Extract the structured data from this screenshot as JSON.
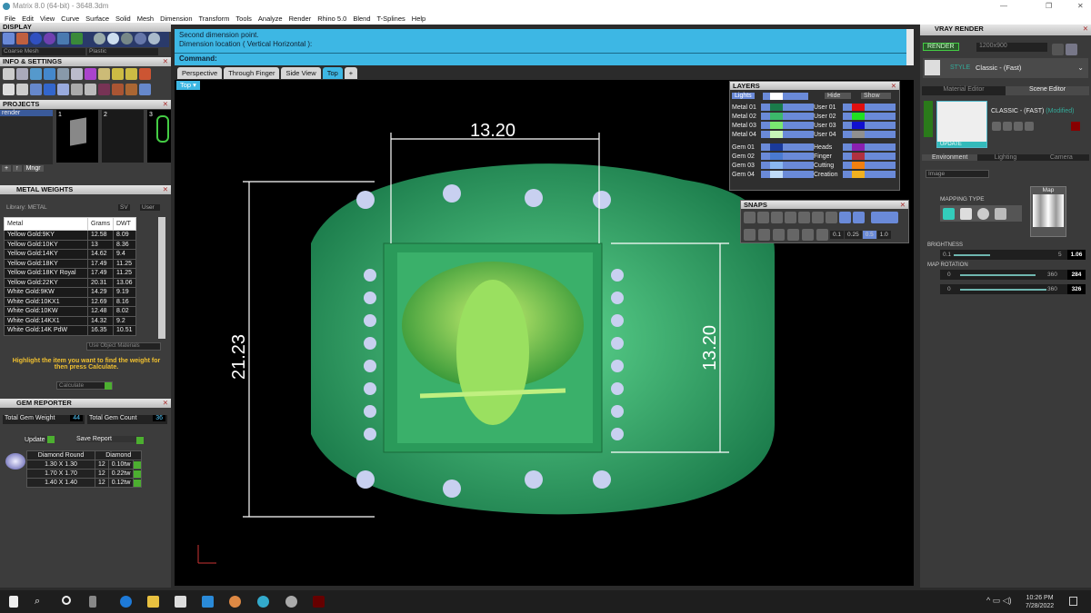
{
  "window": {
    "title": "Matrix 8.0 (64-bit) - 3648.3dm"
  },
  "menu": [
    "File",
    "Edit",
    "View",
    "Curve",
    "Surface",
    "Solid",
    "Mesh",
    "Dimension",
    "Transform",
    "Tools",
    "Analyze",
    "Render",
    "Rhino 5.0",
    "Blend",
    "T-Splines",
    "Help"
  ],
  "display": {
    "title": "DISPLAY",
    "mesh_select": "Coarse Mesh",
    "material_select": "Plastic"
  },
  "info": {
    "title": "INFO & SETTINGS"
  },
  "projects": {
    "title": "PROJECTS",
    "items": [
      "render"
    ],
    "slots": [
      "1",
      "2",
      "3"
    ],
    "buttons": {
      "add": "+",
      "up": "↑",
      "manager": "Mngr"
    }
  },
  "metal_weights": {
    "title": "METAL WEIGHTS",
    "library": "Library: METAL",
    "sv": "SV",
    "user": "User",
    "columns": [
      "Metal",
      "Grams",
      "DWT"
    ],
    "rows": [
      [
        "Yellow Gold:9KY",
        "12.58",
        "8.09"
      ],
      [
        "Yellow Gold:10KY",
        "13",
        "8.36"
      ],
      [
        "Yellow Gold:14KY",
        "14.62",
        "9.4"
      ],
      [
        "Yellow Gold:18KY",
        "17.49",
        "11.25"
      ],
      [
        "Yellow Gold:18KY Royal",
        "17.49",
        "11.25"
      ],
      [
        "Yellow Gold:22KY",
        "20.31",
        "13.06"
      ],
      [
        "White Gold:9KW",
        "14.29",
        "9.19"
      ],
      [
        "White Gold:10KX1",
        "12.69",
        "8.16"
      ],
      [
        "White Gold:10KW",
        "12.48",
        "8.02"
      ],
      [
        "White Gold:14KX1",
        "14.32",
        "9.2"
      ],
      [
        "White Gold:14K PdW",
        "16.35",
        "10.51"
      ]
    ],
    "use_object_materials": "Use Object Materials",
    "hint": "Highlight the item you want to find the weight for then press Calculate.",
    "calculate": "Calculate"
  },
  "gem_reporter": {
    "title": "GEM REPORTER",
    "total_weight_label": "Total Gem Weight",
    "total_weight": "44",
    "total_count_label": "Total Gem Count",
    "total_count": "36",
    "update": "Update",
    "save_report": "Save Report",
    "columns": [
      "Diamond Round",
      "Diamond"
    ],
    "rows": [
      [
        "1.30 X 1.30",
        "12",
        "0.10tw"
      ],
      [
        "1.70 X 1.70",
        "12",
        "0.22tw"
      ],
      [
        "1.40 X 1.40",
        "12",
        "0.12tw"
      ]
    ]
  },
  "command": {
    "line1": "Second dimension point.",
    "line2": "Dimension location ( Vertical  Horizontal ):",
    "prompt": "Command:"
  },
  "view_tabs": [
    "Perspective",
    "Through Finger",
    "Side View",
    "Top"
  ],
  "viewport": {
    "label": "Top",
    "dimensions": {
      "top": "13.20",
      "left": "21.23",
      "right": "13.20"
    }
  },
  "layers": {
    "title": "LAYERS",
    "lights": "Lights",
    "hide": "Hide",
    "show": "Show",
    "left": [
      {
        "name": "Metal 01",
        "color": "#1a7a4a"
      },
      {
        "name": "Metal 02",
        "color": "#3cb86a"
      },
      {
        "name": "Metal 03",
        "color": "#7ae870"
      },
      {
        "name": "Metal 04",
        "color": "#c8f5b8"
      },
      {
        "name": "Gem 01",
        "color": "#1a3a9a"
      },
      {
        "name": "Gem 02",
        "color": "#4a7ad0"
      },
      {
        "name": "Gem 03",
        "color": "#8ab8f0"
      },
      {
        "name": "Gem 04",
        "color": "#c0dcf8"
      }
    ],
    "right": [
      {
        "name": "User 01",
        "color": "#e01010"
      },
      {
        "name": "User 02",
        "color": "#20e020"
      },
      {
        "name": "User 03",
        "color": "#1010d0"
      },
      {
        "name": "User 04",
        "color": "#909090"
      },
      {
        "name": "Heads",
        "color": "#8a20b0"
      },
      {
        "name": "Finger",
        "color": "#b03040"
      },
      {
        "name": "Cutting",
        "color": "#f08010"
      },
      {
        "name": "Creation",
        "color": "#f0b020"
      }
    ]
  },
  "snaps": {
    "title": "SNAPS",
    "values": [
      "0.1",
      "0.25",
      "0.5",
      "1.0"
    ]
  },
  "vray": {
    "title": "VRAY RENDER",
    "render": "RENDER",
    "resolution": "1200x900",
    "style_label": "STYLE",
    "style": "Classic - (Fast)",
    "tabs": [
      "Material Editor",
      "Scene Editor"
    ],
    "preset": "CLASSIC - (FAST)",
    "modified": "(Modified)",
    "update": "UPDATE",
    "env_tabs": [
      "Environment",
      "Lighting",
      "Camera"
    ],
    "env_type": "Image",
    "mapping_type": "MAPPING TYPE",
    "map": "Map",
    "brightness": "BRIGHTNESS",
    "brightness_min": "0.1",
    "brightness_max": "5",
    "brightness_val": "1.06",
    "map_rotation": "MAP ROTATION",
    "rot1_min": "0",
    "rot1_max": "360",
    "rot1_val": "284",
    "rot2_min": "0",
    "rot2_max": "360",
    "rot2_val": "326"
  },
  "taskbar": {
    "time": "10:26 PM",
    "date": "7/28/2022"
  }
}
